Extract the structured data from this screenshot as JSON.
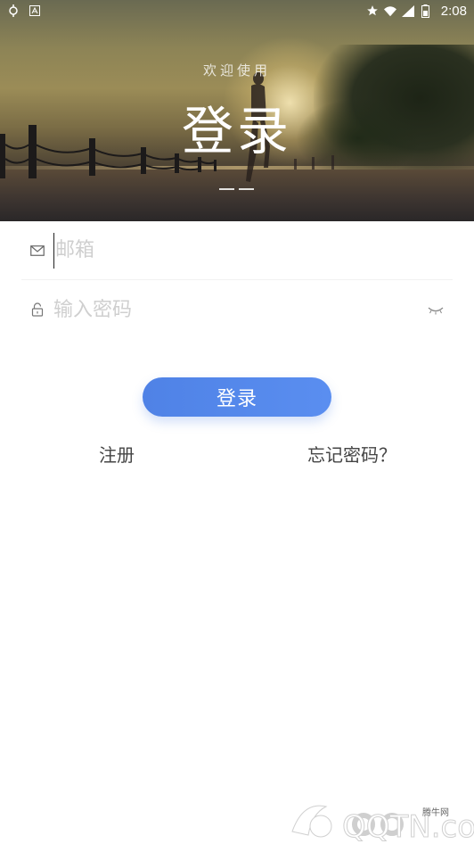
{
  "status_bar": {
    "time": "2:08",
    "left_icons": [
      "sync-icon",
      "a-icon"
    ],
    "right_icons": [
      "star-icon",
      "wifi-icon",
      "signal-icon",
      "battery-icon"
    ]
  },
  "hero": {
    "subtitle": "欢迎使用",
    "title": "登录"
  },
  "form": {
    "email": {
      "placeholder": "邮箱",
      "value": "",
      "icon": "mail-icon"
    },
    "password": {
      "placeholder": "输入密码",
      "value": "",
      "icon": "lock-icon",
      "toggle_icon": "eye-closed-icon"
    },
    "login_label": "登录",
    "register_label": "注册",
    "forgot_label": "忘记密码？"
  },
  "colors": {
    "accent": "#5588ec",
    "placeholder": "#cfcfcf",
    "link_text": "#444444"
  },
  "watermark": {
    "text_small": "腾牛网",
    "text_large": "QQTN.com"
  }
}
